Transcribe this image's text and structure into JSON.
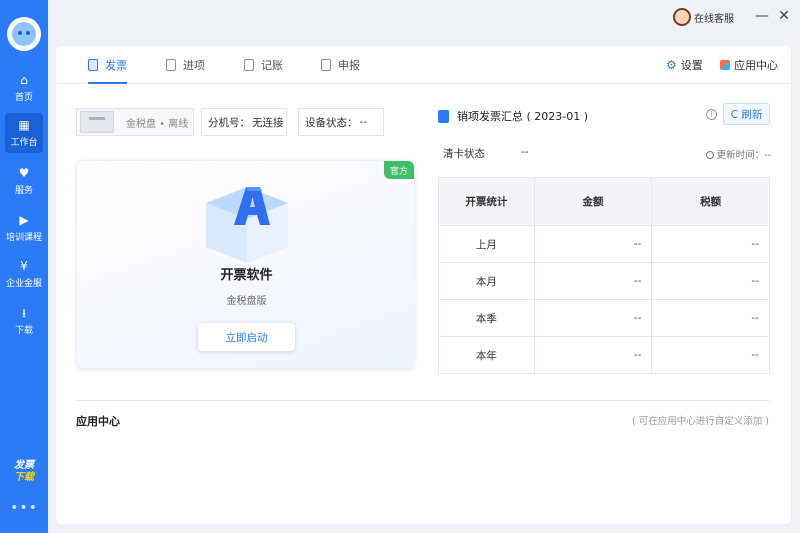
{
  "sidebar": {
    "items": [
      {
        "label": "首页",
        "icon": "home-icon",
        "glyph": "⌂"
      },
      {
        "label": "工作台",
        "icon": "grid-icon",
        "glyph": "▦"
      },
      {
        "label": "服务",
        "icon": "heart-hand-icon",
        "glyph": "♥"
      },
      {
        "label": "培训课程",
        "icon": "video-icon",
        "glyph": "▶"
      },
      {
        "label": "企业金服",
        "icon": "finance-icon",
        "glyph": "¥"
      },
      {
        "label": "下载",
        "icon": "download-icon",
        "glyph": "⭳"
      }
    ],
    "active_index": 1,
    "promo_line1": "发票",
    "promo_line2": "下载",
    "more": "•••"
  },
  "titlebar": {
    "service_label": "在线客服",
    "minimize": "—",
    "close": "✕"
  },
  "tabs": [
    {
      "label": "发票"
    },
    {
      "label": "进项"
    },
    {
      "label": "记账"
    },
    {
      "label": "申报"
    }
  ],
  "header_links": {
    "settings": "设置",
    "app_center": "应用中心"
  },
  "device": {
    "name": "金税盘 • 离线",
    "extension_label": "分机号：",
    "extension_value": "无连接",
    "status_label": "设备状态：",
    "status_value": "--"
  },
  "software": {
    "badge": "官方",
    "name": "开票软件",
    "edition": "金税盘版",
    "launch_label": "立即启动"
  },
  "summary": {
    "title": "销项发票汇总 ( 2023-01 )",
    "info": "i",
    "refresh_label": "C 刷新",
    "clear_label": "清卡状态",
    "clear_value": "--",
    "update_label": "更新时间：--",
    "columns": [
      "开票统计",
      "金额",
      "税额"
    ],
    "rows": [
      {
        "period": "上月",
        "amount": "--",
        "tax": "--"
      },
      {
        "period": "本月",
        "amount": "--",
        "tax": "--"
      },
      {
        "period": "本季",
        "amount": "--",
        "tax": "--"
      },
      {
        "period": "本年",
        "amount": "--",
        "tax": "--"
      }
    ]
  },
  "app_center": {
    "title": "应用中心",
    "hint": "( 可在应用中心进行自定义添加 )"
  },
  "colors": {
    "primary": "#2b7bf6",
    "sidebar": "#2b7bf6",
    "badge_green": "#3fbf6a"
  }
}
